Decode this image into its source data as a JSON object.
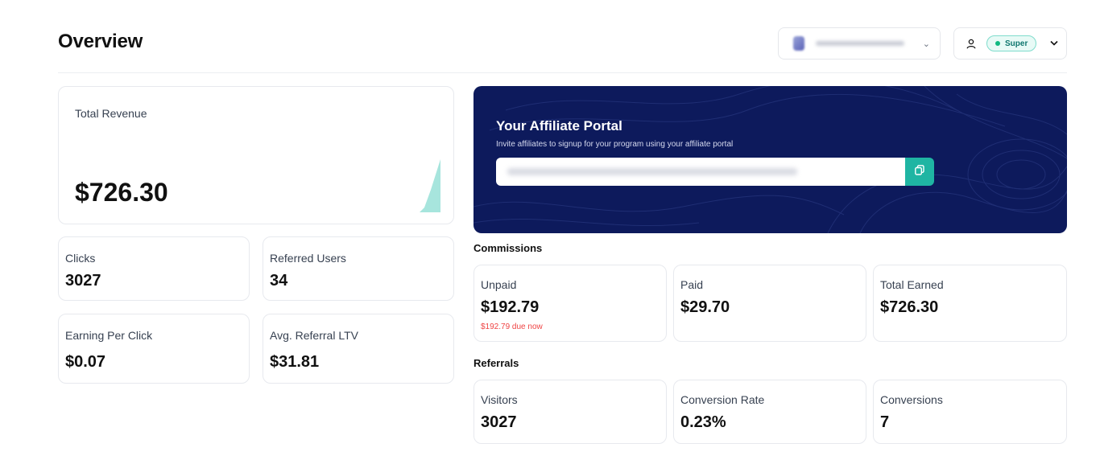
{
  "header": {
    "title": "Overview",
    "plan_badge": "Super"
  },
  "revenue": {
    "label": "Total Revenue",
    "value": "$726.30"
  },
  "metrics": {
    "clicks": {
      "label": "Clicks",
      "value": "3027"
    },
    "referred_users": {
      "label": "Referred Users",
      "value": "34"
    },
    "earning_per_click": {
      "label": "Earning Per Click",
      "value": "$0.07"
    },
    "avg_referral_ltv": {
      "label": "Avg. Referral LTV",
      "value": "$31.81"
    }
  },
  "portal": {
    "title": "Your Affiliate Portal",
    "subtitle": "Invite affiliates to signup for your program using your affiliate portal"
  },
  "commissions": {
    "title": "Commissions",
    "unpaid": {
      "label": "Unpaid",
      "value": "$192.79",
      "note": "$192.79 due now"
    },
    "paid": {
      "label": "Paid",
      "value": "$29.70"
    },
    "total_earned": {
      "label": "Total Earned",
      "value": "$726.30"
    }
  },
  "referrals": {
    "title": "Referrals",
    "visitors": {
      "label": "Visitors",
      "value": "3027"
    },
    "conversion_rate": {
      "label": "Conversion Rate",
      "value": "0.23%"
    },
    "conversions": {
      "label": "Conversions",
      "value": "7"
    }
  },
  "colors": {
    "portal_bg": "#0d1a5c",
    "accent_teal": "#1fb5a3",
    "due_red": "#ef4444"
  }
}
